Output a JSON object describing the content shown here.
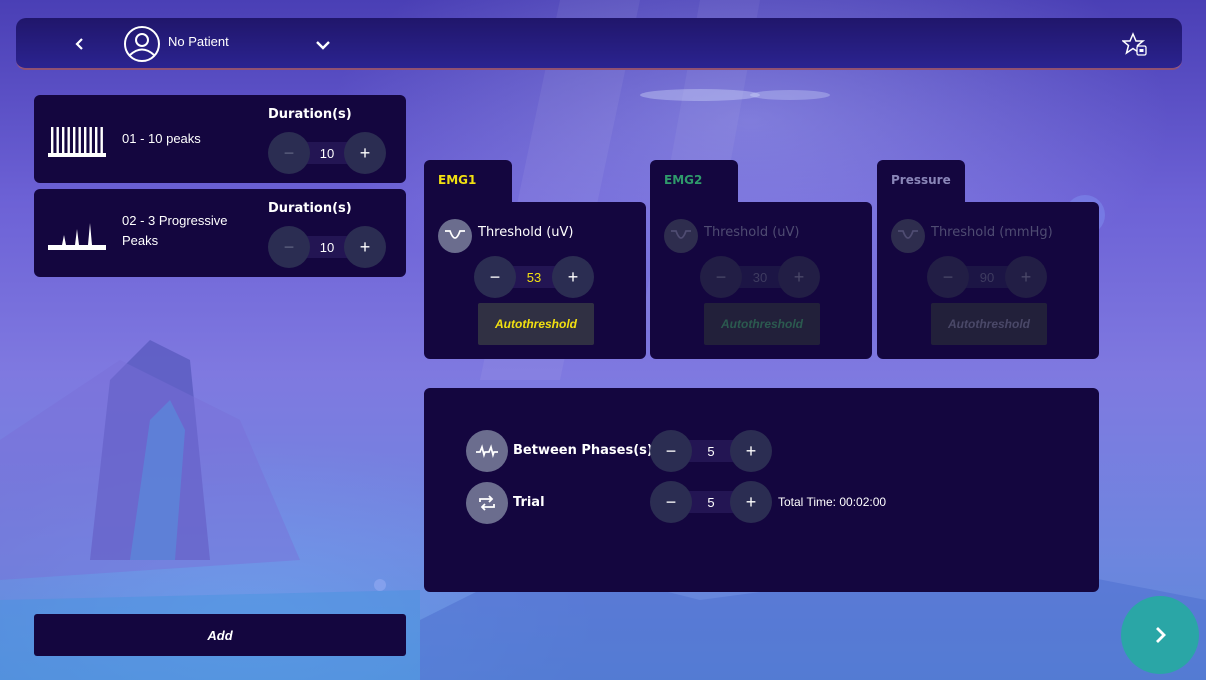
{
  "header": {
    "patient_name": "No Patient"
  },
  "protocols": [
    {
      "name": "01 - 10 peaks",
      "duration_label": "Duration(s)",
      "duration_value": "10",
      "minus": "−",
      "plus": "+"
    },
    {
      "name": "02 - 3 Progressive Peaks",
      "duration_label": "Duration(s)",
      "duration_value": "10",
      "minus": "−",
      "plus": "+"
    }
  ],
  "add_label": "Add",
  "sensors": [
    {
      "tab": "EMG1",
      "label": "Threshold (uV)",
      "value": "53",
      "auto_label": "Autothreshold",
      "active": true,
      "tab_color": "#f2e011",
      "value_color": "#f2e011"
    },
    {
      "tab": "EMG2",
      "label": "Threshold (uV)",
      "value": "30",
      "auto_label": "Autothreshold",
      "active": false,
      "tab_color": "#2f9a6b",
      "value_color": "#3e3b60"
    },
    {
      "tab": "Pressure",
      "label": "Threshold (mmHg)",
      "value": "90",
      "auto_label": "Autothreshold",
      "active": false,
      "tab_color": "#8a86b8",
      "value_color": "#3e3b60"
    }
  ],
  "phases": {
    "between_label": "Between Phases(s)",
    "between_value": "5",
    "trial_label": "Trial",
    "trial_value": "5",
    "total_time": "Total Time: 00:02:00"
  },
  "colors": {
    "accent_yellow": "#f2e011",
    "panel": "#14063f",
    "next_button": "#2aa6a6"
  },
  "icons": {
    "back": "chevron-left-icon",
    "avatar": "user-circle-icon",
    "dropdown": "chevron-down-icon",
    "favorite": "star-save-icon",
    "threshold": "threshold-curve-icon",
    "between_phases": "phase-gap-icon",
    "trial": "repeat-icon",
    "next": "chevron-right-icon"
  }
}
